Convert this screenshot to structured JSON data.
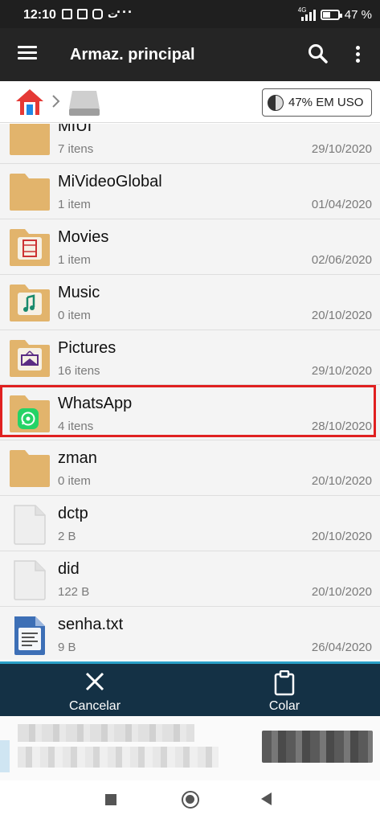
{
  "status_bar": {
    "time": "12:10",
    "network": "4G",
    "battery": "47 %",
    "battery_level": 0.47
  },
  "app_bar": {
    "menu_icon": "hamburger-icon",
    "title": "Armaz. principal",
    "search_icon": "search-icon",
    "more_icon": "more-vert-icon"
  },
  "breadcrumb": {
    "home_icon": "home-icon",
    "drive_icon": "storage-drive-icon",
    "usage": "47% EM USO"
  },
  "files": [
    {
      "name": "MIUI",
      "sub": "7 itens",
      "date": "29/10/2020",
      "icon": "folder-icon"
    },
    {
      "name": "MiVideoGlobal",
      "sub": "1 item",
      "date": "01/04/2020",
      "icon": "folder-icon"
    },
    {
      "name": "Movies",
      "sub": "1 item",
      "date": "02/06/2020",
      "icon": "folder-movies-icon"
    },
    {
      "name": "Music",
      "sub": "0 item",
      "date": "20/10/2020",
      "icon": "folder-music-icon"
    },
    {
      "name": "Pictures",
      "sub": "16 itens",
      "date": "29/10/2020",
      "icon": "folder-pictures-icon"
    },
    {
      "name": "WhatsApp",
      "sub": "4 itens",
      "date": "28/10/2020",
      "icon": "folder-whatsapp-icon"
    },
    {
      "name": "zman",
      "sub": "0 item",
      "date": "20/10/2020",
      "icon": "folder-icon"
    },
    {
      "name": "dctp",
      "sub": "2 B",
      "date": "20/10/2020",
      "icon": "file-icon"
    },
    {
      "name": "did",
      "sub": "122 B",
      "date": "20/10/2020",
      "icon": "file-icon"
    },
    {
      "name": "senha.txt",
      "sub": "9 B",
      "date": "26/04/2020",
      "icon": "text-file-icon"
    }
  ],
  "actions": {
    "cancel": "Cancelar",
    "paste": "Colar"
  },
  "colors": {
    "app_bar": "#252525",
    "action_bar": "#143145",
    "folder": "#e2b46c",
    "highlight": "#e02020"
  }
}
